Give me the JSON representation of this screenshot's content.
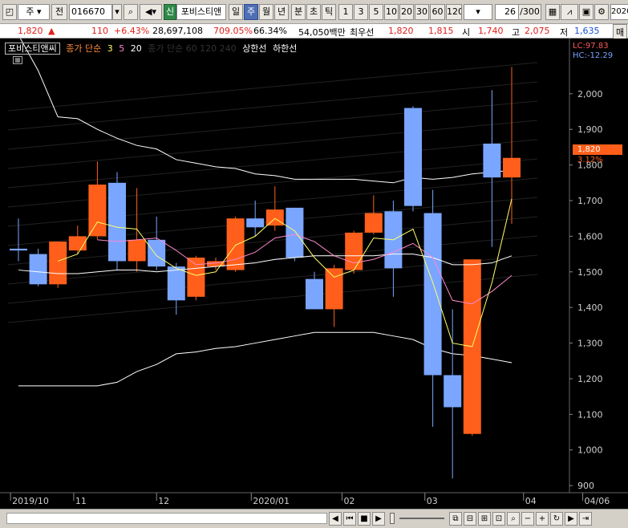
{
  "toolbar": {
    "period_label": "주",
    "jeon_label": "전",
    "code": "016670",
    "stock_name": "포비스티앤",
    "period_tabs": [
      "일",
      "주",
      "월",
      "년"
    ],
    "period_selected": "주",
    "intraday_tabs": [
      "분",
      "초",
      "틱"
    ],
    "interval_numbers": [
      "1",
      "3",
      "5",
      "10",
      "20",
      "30",
      "60",
      "120"
    ],
    "page_counter": "26",
    "page_total": "/300",
    "year_field": "2020"
  },
  "inforow": {
    "price": "1,820",
    "change": "110",
    "change_pct": "+6.43%",
    "volume": "28,697,108",
    "volume_ratio": "709.05%",
    "turnover": "66.34%",
    "amount": "54,050백만",
    "best_label": "최우선",
    "best_sell": "1,820",
    "best_buy": "1,815",
    "open_label": "시",
    "open": "1,740",
    "high_label": "고",
    "high": "2,075",
    "low_label": "저",
    "low": "1,635",
    "trade_btn": "매"
  },
  "legend": {
    "name": "포비스티앤씨",
    "ma_label": "종가 단순",
    "ma_periods": [
      "3",
      "5",
      "20"
    ],
    "ma_faded": "종가 단순 60 120 240",
    "upper_limit": "상한선",
    "lower_limit": "하한선"
  },
  "axis_right": {
    "lc": "LC:97.83",
    "hc": "HC:-12.29",
    "current_price": "1,820",
    "current_pct": "3.12%"
  },
  "colors": {
    "up": "#ff5f1a",
    "down": "#7aa6ff",
    "ma3": "#ffff66",
    "ma5": "#ff88cc",
    "ma20": "#ffffff"
  },
  "chart_data": {
    "type": "candlestick",
    "y_ticks": [
      900,
      1000,
      1100,
      1200,
      1300,
      1400,
      1500,
      1600,
      1700,
      1800,
      1900,
      2000
    ],
    "y_tick_labels": [
      "900",
      "1,000",
      "1,100",
      "1,200",
      "1,300",
      "1,400",
      "1,500",
      "1,600",
      "1,700",
      "1,800",
      "1,900",
      "2,000"
    ],
    "ylim": [
      880,
      2110
    ],
    "x_labels": [
      {
        "label": "2019/10",
        "index": -0.4
      },
      {
        "label": "11",
        "index": 2.8
      },
      {
        "label": "12",
        "index": 7.0
      },
      {
        "label": "2020/01",
        "index": 11.8
      },
      {
        "label": "02",
        "index": 16.4
      },
      {
        "label": "03",
        "index": 20.6
      },
      {
        "label": "04",
        "index": 25.6
      },
      {
        "label": "04/06",
        "index": 28.6
      }
    ],
    "candles": [
      {
        "o": 1565,
        "h": 1650,
        "l": 1530,
        "c": 1560
      },
      {
        "o": 1550,
        "h": 1565,
        "l": 1460,
        "c": 1465
      },
      {
        "o": 1465,
        "h": 1565,
        "l": 1455,
        "c": 1585
      },
      {
        "o": 1560,
        "h": 1630,
        "l": 1550,
        "c": 1600
      },
      {
        "o": 1600,
        "h": 1810,
        "l": 1590,
        "c": 1745
      },
      {
        "o": 1750,
        "h": 1780,
        "l": 1505,
        "c": 1530
      },
      {
        "o": 1530,
        "h": 1735,
        "l": 1500,
        "c": 1590
      },
      {
        "o": 1590,
        "h": 1655,
        "l": 1505,
        "c": 1515
      },
      {
        "o": 1515,
        "h": 1525,
        "l": 1380,
        "c": 1420
      },
      {
        "o": 1430,
        "h": 1545,
        "l": 1420,
        "c": 1540
      },
      {
        "o": 1515,
        "h": 1540,
        "l": 1505,
        "c": 1530
      },
      {
        "o": 1505,
        "h": 1655,
        "l": 1500,
        "c": 1650
      },
      {
        "o": 1650,
        "h": 1700,
        "l": 1600,
        "c": 1625
      },
      {
        "o": 1630,
        "h": 1740,
        "l": 1615,
        "c": 1675
      },
      {
        "o": 1680,
        "h": 1680,
        "l": 1530,
        "c": 1540
      },
      {
        "o": 1480,
        "h": 1500,
        "l": 1395,
        "c": 1395
      },
      {
        "o": 1395,
        "h": 1520,
        "l": 1345,
        "c": 1510
      },
      {
        "o": 1505,
        "h": 1615,
        "l": 1495,
        "c": 1610
      },
      {
        "o": 1610,
        "h": 1715,
        "l": 1605,
        "c": 1665
      },
      {
        "o": 1670,
        "h": 1700,
        "l": 1430,
        "c": 1510
      },
      {
        "o": 1960,
        "h": 1965,
        "l": 1670,
        "c": 1685
      },
      {
        "o": 1665,
        "h": 1730,
        "l": 1065,
        "c": 1210
      },
      {
        "o": 1210,
        "h": 1395,
        "l": 920,
        "c": 1120
      },
      {
        "o": 1045,
        "h": 1535,
        "l": 1040,
        "c": 1535
      },
      {
        "o": 1860,
        "h": 2010,
        "l": 1570,
        "c": 1765
      },
      {
        "o": 1765,
        "h": 2075,
        "l": 1635,
        "c": 1820
      }
    ],
    "series": [
      {
        "name": "3",
        "values": [
          null,
          null,
          1530,
          1550,
          1640,
          1625,
          1620,
          1545,
          1510,
          1490,
          1500,
          1575,
          1600,
          1650,
          1615,
          1540,
          1485,
          1505,
          1595,
          1590,
          1620,
          1470,
          1300,
          1290,
          1470,
          1705
        ]
      },
      {
        "name": "5",
        "values": [
          null,
          null,
          null,
          null,
          1590,
          1585,
          1590,
          1595,
          1560,
          1520,
          1525,
          1535,
          1555,
          1595,
          1605,
          1585,
          1545,
          1525,
          1535,
          1555,
          1580,
          1540,
          1420,
          1410,
          1445,
          1490
        ]
      },
      {
        "name": "20",
        "values": [
          1505,
          1500,
          1495,
          1495,
          1500,
          1505,
          1505,
          1500,
          1505,
          1510,
          1515,
          1520,
          1525,
          1535,
          1540,
          1545,
          1545,
          1545,
          1545,
          1550,
          1550,
          1540,
          1520,
          1520,
          1525,
          1545
        ]
      }
    ],
    "upper_limit": [
      2165,
      2065,
      1935,
      1930,
      1900,
      1875,
      1855,
      1845,
      1815,
      1805,
      1795,
      1790,
      1775,
      1770,
      1760,
      1760,
      1760,
      1760,
      1755,
      1750,
      1765,
      1760,
      1765,
      1775,
      1780,
      1785
    ],
    "lower_limit": [
      1180,
      1180,
      1180,
      1180,
      1180,
      1190,
      1220,
      1240,
      1270,
      1275,
      1285,
      1290,
      1300,
      1310,
      1320,
      1330,
      1330,
      1330,
      1330,
      1320,
      1310,
      1285,
      1270,
      1265,
      1255,
      1245
    ]
  },
  "bottom": {
    "zoom_minus": "−",
    "zoom_plus": "+",
    "search_glyph": "⌕"
  }
}
